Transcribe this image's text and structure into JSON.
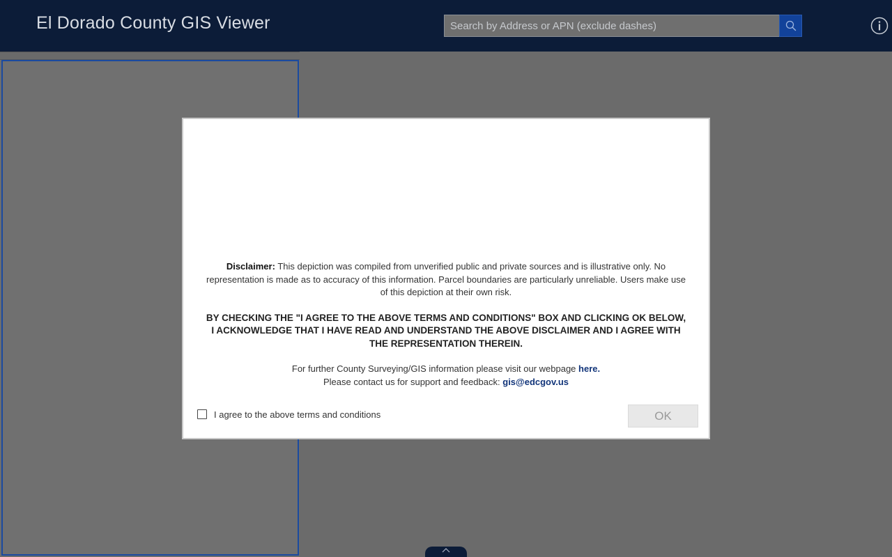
{
  "header": {
    "title": "El Dorado County GIS Viewer",
    "search_placeholder": "Search by Address or APN (exclude dashes)",
    "search_icon": "search-icon",
    "info_icon": "info-icon"
  },
  "modal": {
    "disclaimer_label": "Disclaimer:",
    "disclaimer_text": "This depiction was compiled from unverified public and private sources and is illustrative only. No representation is made as to accuracy of this information. Parcel boundaries are particularly unreliable. Users make use of this depiction at their own risk.",
    "acknowledgement": "BY CHECKING THE \"I AGREE TO THE ABOVE TERMS AND CONDITIONS\" BOX AND CLICKING OK BELOW, I ACKNOWLEDGE THAT I HAVE READ AND UNDERSTAND THE ABOVE DISCLAIMER AND I AGREE WITH THE REPRESENTATION THEREIN.",
    "further_info_text": "For further County Surveying/GIS information please visit our webpage",
    "webpage_link": "here.",
    "contact_text": "Please contact us for support and feedback:",
    "contact_email": "gis@edcgov.us",
    "agree_label": "I agree to the above terms and conditions",
    "agree_checked": false,
    "ok_label": "OK"
  },
  "colors": {
    "header_bg": "#0c1c38",
    "search_button": "#12429a",
    "panel_border": "#1a4aa0",
    "link": "#12357a"
  }
}
